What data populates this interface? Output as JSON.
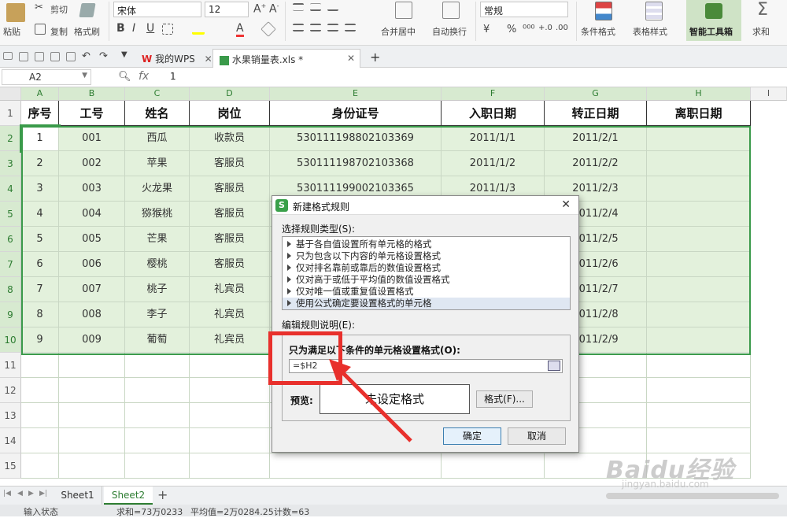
{
  "ribbon": {
    "paste": "粘贴",
    "cut": "剪切",
    "copy": "复制",
    "format_painter": "格式刷",
    "font_name": "宋体",
    "font_size": "12",
    "merge_center": "合并居中",
    "wrap_text": "自动换行",
    "number_format": "常规",
    "cond_format": "条件格式",
    "table_style": "表格样式",
    "smart_toolbox": "智能工具箱",
    "sum": "求和"
  },
  "tabs": {
    "wps_home": "我的WPS",
    "file_tab": "水果销量表.xls *"
  },
  "formula_bar": {
    "cell_ref": "A2",
    "fx": "fx",
    "value": "1"
  },
  "columns": {
    "labels": [
      "A",
      "B",
      "C",
      "D",
      "E",
      "F",
      "G",
      "H",
      "I"
    ]
  },
  "rows": {
    "numbers": [
      "1",
      "2",
      "3",
      "4",
      "5",
      "6",
      "7",
      "8",
      "9",
      "10",
      "11",
      "12",
      "13",
      "14",
      "15"
    ]
  },
  "table": {
    "headers": [
      "序号",
      "工号",
      "姓名",
      "岗位",
      "身份证号",
      "入职日期",
      "转正日期",
      "离职日期"
    ],
    "rows": [
      [
        "1",
        "001",
        "西瓜",
        "收款员",
        "530111198802103369",
        "2011/1/1",
        "2011/2/1",
        ""
      ],
      [
        "2",
        "002",
        "苹果",
        "客服员",
        "530111198702103368",
        "2011/1/2",
        "2011/2/2",
        ""
      ],
      [
        "3",
        "003",
        "火龙果",
        "客服员",
        "530111199002103365",
        "2011/1/3",
        "2011/2/3",
        ""
      ],
      [
        "4",
        "004",
        "猕猴桃",
        "客服员",
        "",
        "",
        "2011/2/4",
        ""
      ],
      [
        "5",
        "005",
        "芒果",
        "客服员",
        "",
        "",
        "2011/2/5",
        ""
      ],
      [
        "6",
        "006",
        "樱桃",
        "客服员",
        "",
        "",
        "2011/2/6",
        ""
      ],
      [
        "7",
        "007",
        "桃子",
        "礼宾员",
        "",
        "",
        "2011/2/7",
        ""
      ],
      [
        "8",
        "008",
        "李子",
        "礼宾员",
        "",
        "",
        "2011/2/8",
        ""
      ],
      [
        "9",
        "009",
        "葡萄",
        "礼宾员",
        "",
        "",
        "2011/2/9",
        ""
      ]
    ]
  },
  "dialog": {
    "title": "新建格式规则",
    "rule_type_label": "选择规则类型(S):",
    "rule_types": [
      "基于各自值设置所有单元格的格式",
      "只为包含以下内容的单元格设置格式",
      "仅对排名靠前或靠后的数值设置格式",
      "仅对高于或低于平均值的数值设置格式",
      "仅对唯一值或重复值设置格式",
      "使用公式确定要设置格式的单元格"
    ],
    "desc_label": "编辑规则说明(E):",
    "formula_label": "只为满足以下条件的单元格设置格式(O):",
    "formula_value": "=$H2",
    "preview_label": "预览:",
    "preview_text": "未设定格式",
    "format_button": "格式(F)...",
    "ok": "确定",
    "cancel": "取消"
  },
  "sheets": {
    "sheet1": "Sheet1",
    "sheet2": "Sheet2",
    "add": "+"
  },
  "status": {
    "mode": "输入状态",
    "sum": "求和=73万0233",
    "avg": "平均值=2万0284.25",
    "count": "计数=63"
  },
  "watermark": {
    "text": "Baidu经验",
    "url": "jingyan.baidu.com"
  },
  "colors": {
    "accent_green": "#2e7d32",
    "highlight": "#e3f1dc",
    "annotation_red": "#e8302c"
  }
}
